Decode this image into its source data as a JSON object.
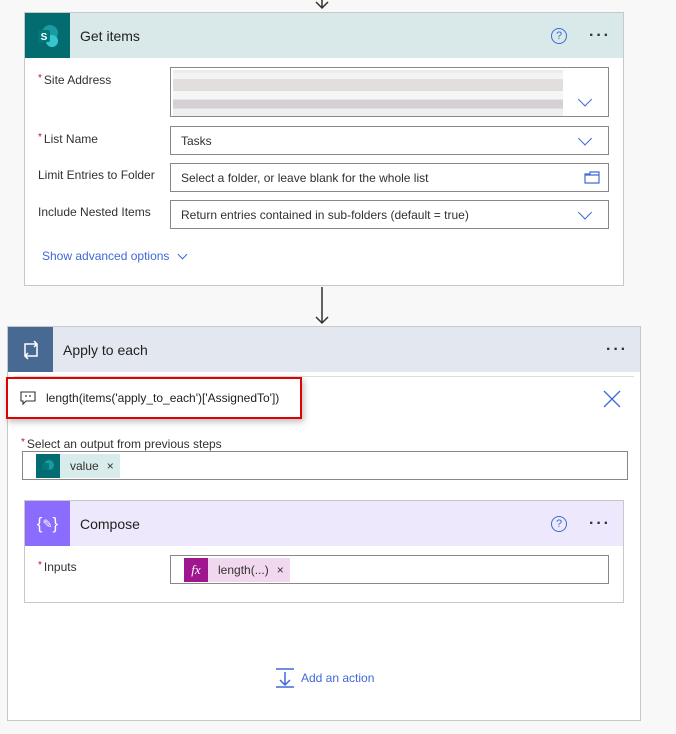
{
  "get_items": {
    "title": "Get items",
    "fields": [
      {
        "label": "Site Address",
        "required": true,
        "value": ""
      },
      {
        "label": "List Name",
        "required": true,
        "value": "Tasks"
      },
      {
        "label": "Limit Entries to Folder",
        "required": false,
        "placeholder": "Select a folder, or leave blank for the whole list"
      },
      {
        "label": "Include Nested Items",
        "required": false,
        "placeholder": "Return entries contained in sub-folders (default = true)"
      }
    ],
    "advanced_label": "Show advanced options"
  },
  "apply_to_each": {
    "title": "Apply to each",
    "expression": "length(items('apply_to_each')['AssignedTo'])",
    "output_label": "Select an output from previous steps",
    "output_token": "value"
  },
  "compose": {
    "title": "Compose",
    "inputs_label": "Inputs",
    "inputs_token": "length(...)",
    "fx_label": "fx"
  },
  "add_action_label": "Add an action",
  "colors": {
    "sharepoint": "#036c70",
    "loop": "#486991",
    "compose": "#8c6cff",
    "expression": "#a0168e",
    "accent": "#3f69d8",
    "highlight": "#e00000"
  }
}
